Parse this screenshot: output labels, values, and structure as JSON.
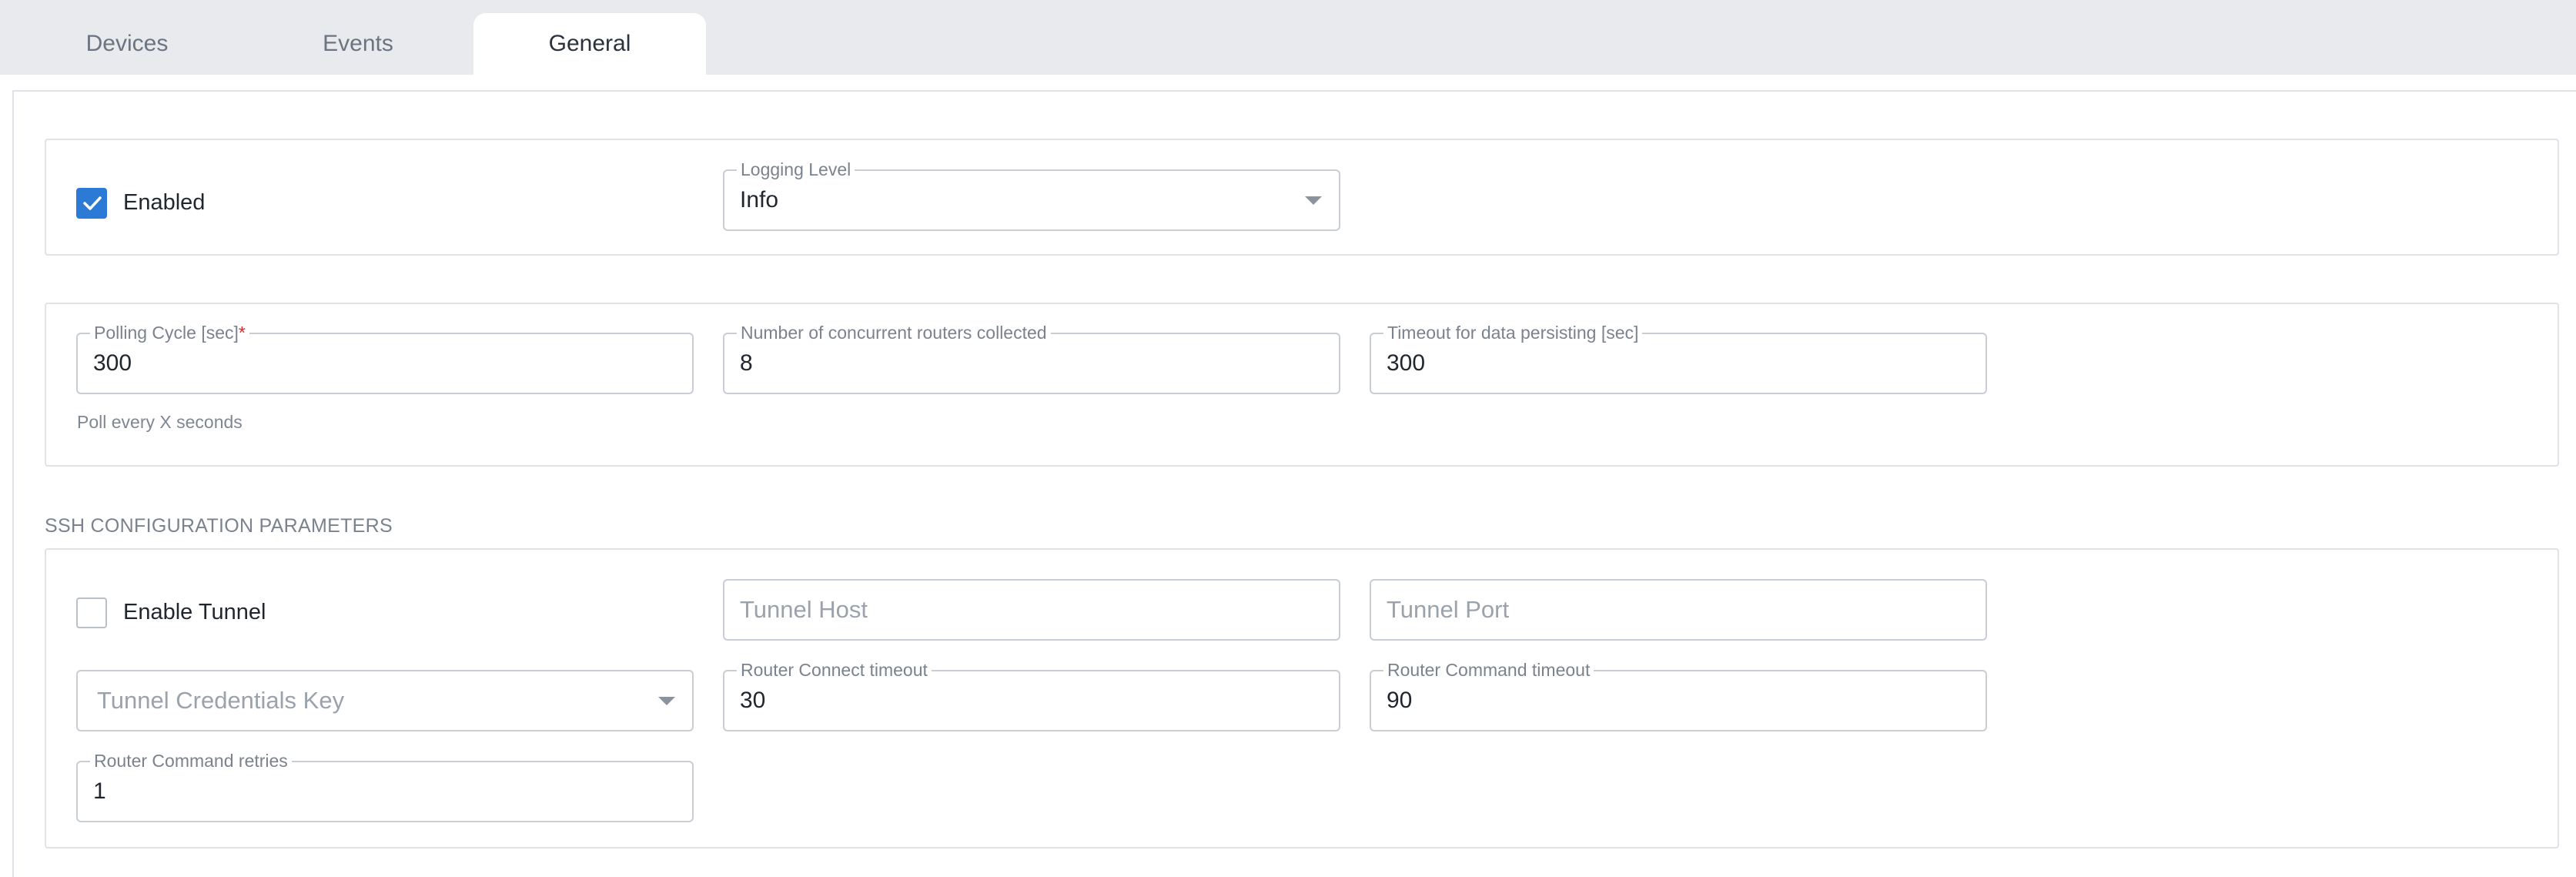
{
  "tabs": [
    {
      "label": "Devices",
      "active": false
    },
    {
      "label": "Events",
      "active": false
    },
    {
      "label": "General",
      "active": true
    }
  ],
  "general": {
    "enabled": {
      "label": "Enabled",
      "checked": true
    },
    "logging_level": {
      "label": "Logging Level",
      "value": "Info"
    }
  },
  "polling": {
    "cycle": {
      "label": "Polling Cycle [sec]",
      "required_mark": "*",
      "value": "300",
      "helper": "Poll every X seconds"
    },
    "concurrent": {
      "label": "Number of concurrent routers collected",
      "value": "8"
    },
    "timeout_persist": {
      "label": "Timeout for data persisting [sec]",
      "value": "300"
    }
  },
  "ssh": {
    "section_title": "SSH CONFIGURATION PARAMETERS",
    "enable_tunnel": {
      "label": "Enable Tunnel",
      "checked": false
    },
    "tunnel_host": {
      "placeholder": "Tunnel Host"
    },
    "tunnel_port": {
      "placeholder": "Tunnel Port"
    },
    "credentials_key": {
      "placeholder": "Tunnel Credentials Key"
    },
    "connect_timeout": {
      "label": "Router Connect timeout",
      "value": "30"
    },
    "command_timeout": {
      "label": "Router Command timeout",
      "value": "90"
    },
    "command_retries": {
      "label": "Router Command retries",
      "value": "1"
    }
  },
  "colors": {
    "accent": "#2b7bd6",
    "required": "#e02424",
    "tabbar_bg": "#e8eaed",
    "border": "#c9ced4"
  },
  "icons": {
    "checkmark": "check-icon",
    "dropdown": "chevron-down-icon"
  }
}
